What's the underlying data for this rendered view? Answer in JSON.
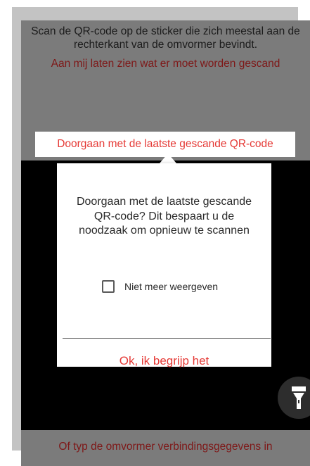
{
  "instructions": {
    "text": "Scan de QR-code op de sticker die zich meestal aan de rechterkant van de omvormer bevindt.",
    "show_scan_link": "Aan mij laten zien wat er moet worden gescand"
  },
  "continue_button": {
    "label": "Doorgaan met de laatste gescande QR-code"
  },
  "dialog": {
    "message": "Doorgaan met de laatste gescande QR-code? Dit bespaart u de noodzaak om opnieuw te scannen",
    "checkbox_label": "Niet meer weergeven",
    "checkbox_checked": false,
    "ok_label": "Ok, ik begrijp het"
  },
  "flashlight": {
    "icon": "flashlight-icon"
  },
  "footer": {
    "manual_entry_link": "Of typ de omvormer verbindingsgegevens in"
  },
  "colors": {
    "accent_red": "#e53935",
    "dark_red": "#7e1818",
    "overlay_gray": "#7b7b7b",
    "camera_black": "#000000"
  }
}
